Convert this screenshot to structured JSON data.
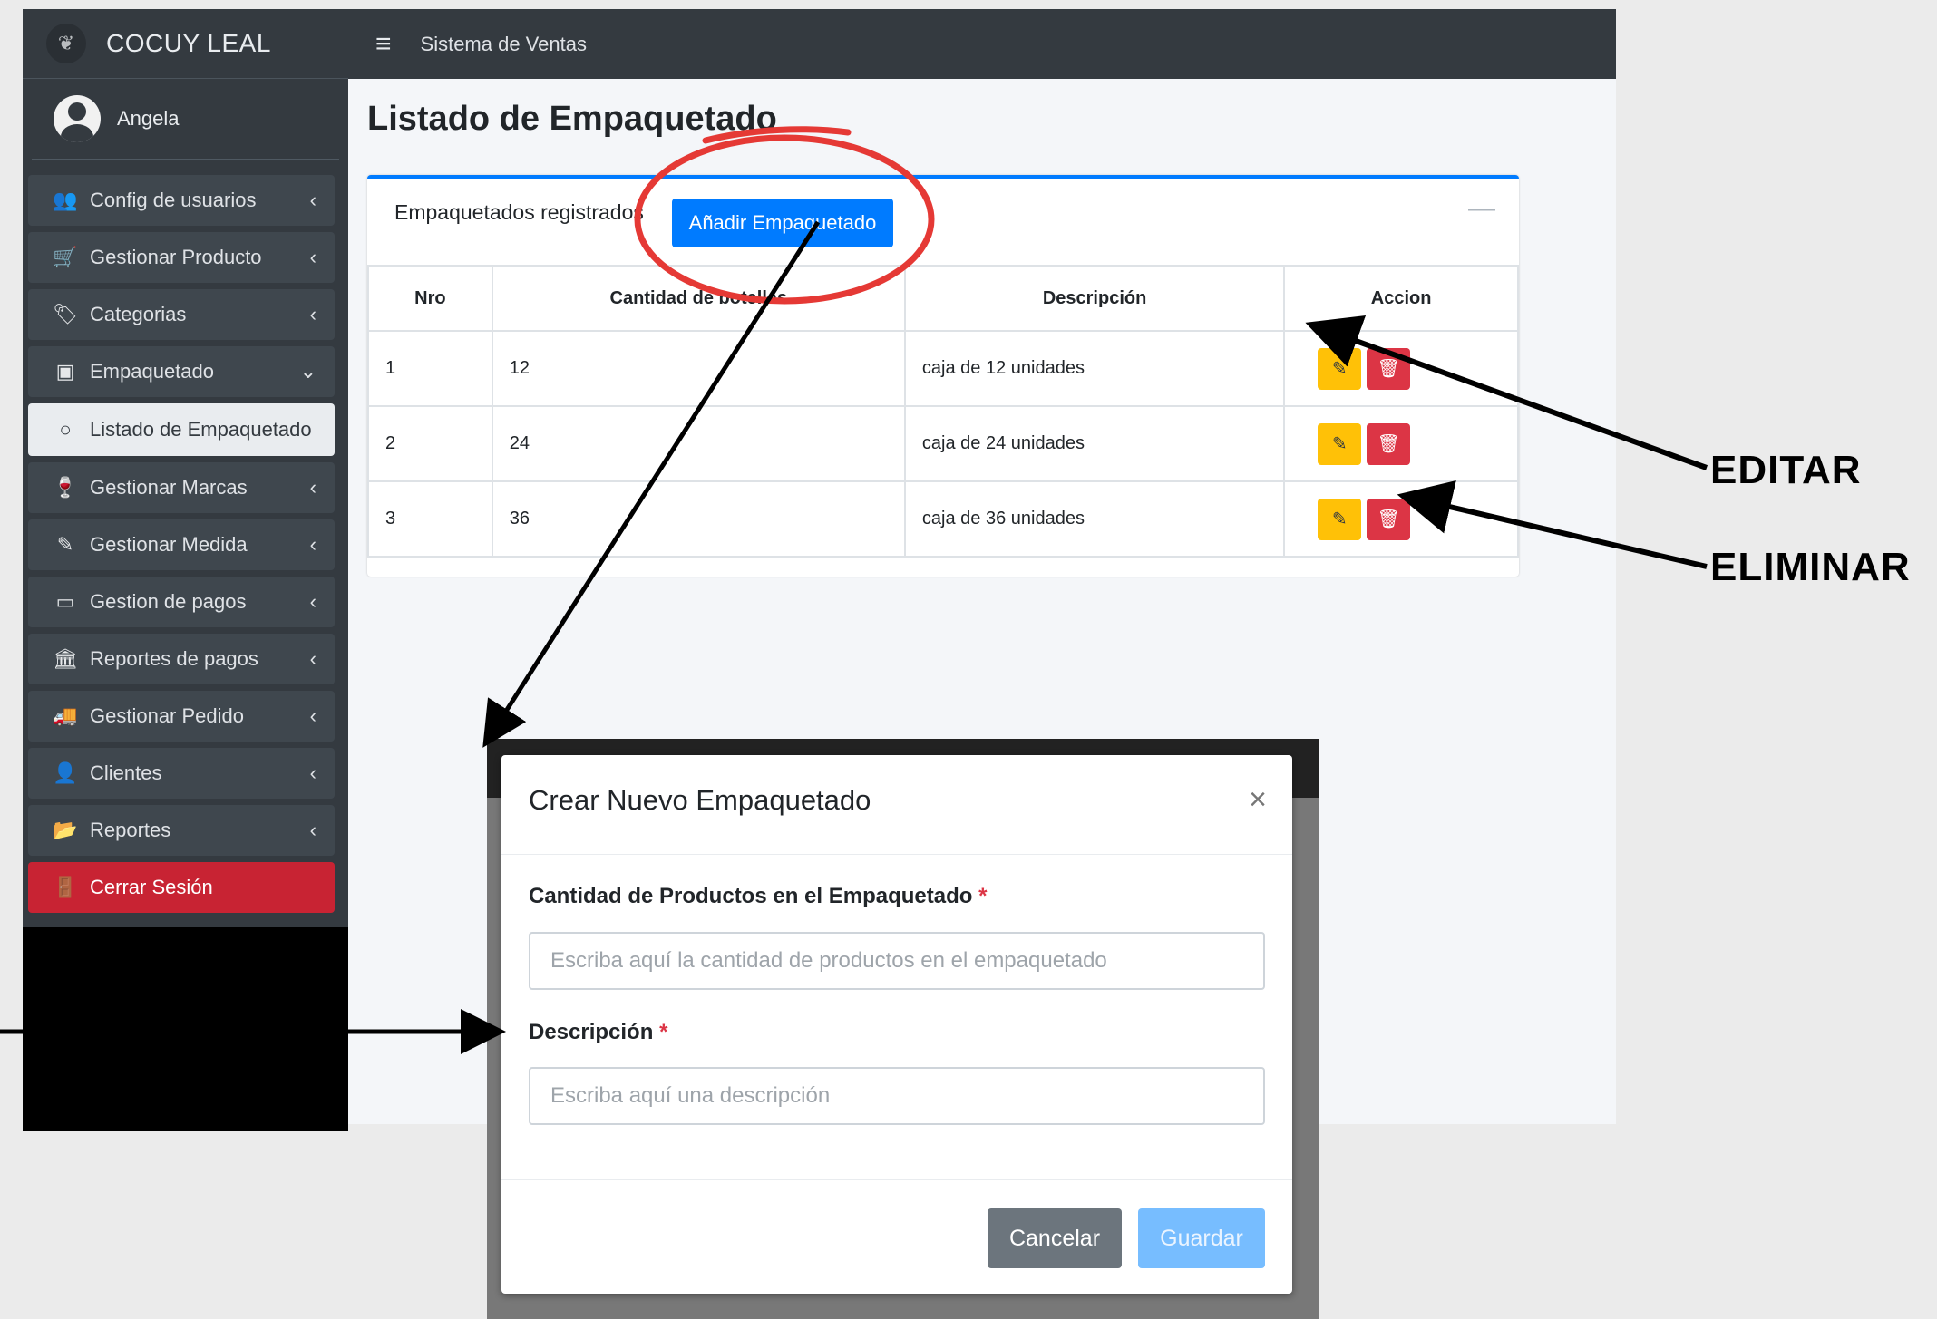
{
  "brand": {
    "name": "COCUY LEAL",
    "logo_icon": "leaf-logo-icon"
  },
  "user": {
    "name": "Angela"
  },
  "topbar": {
    "title": "Sistema de Ventas"
  },
  "sidebar": {
    "items": [
      {
        "label": "Config de usuarios",
        "icon": "users-icon"
      },
      {
        "label": "Gestionar Producto",
        "icon": "cart-icon"
      },
      {
        "label": "Categorias",
        "icon": "tags-icon"
      },
      {
        "label": "Empaquetado",
        "icon": "box-icon"
      },
      {
        "label": "Listado de Empaquetado",
        "icon": "circle-icon"
      },
      {
        "label": "Gestionar Marcas",
        "icon": "wine-icon"
      },
      {
        "label": "Gestionar Medida",
        "icon": "eyedropper-icon"
      },
      {
        "label": "Gestion de pagos",
        "icon": "credit-card-icon"
      },
      {
        "label": "Reportes de pagos",
        "icon": "bank-icon"
      },
      {
        "label": "Gestionar Pedido",
        "icon": "truck-icon"
      },
      {
        "label": "Clientes",
        "icon": "user-tie-icon"
      },
      {
        "label": "Reportes",
        "icon": "folder-icon"
      },
      {
        "label": "Cerrar Sesión",
        "icon": "door-icon"
      }
    ]
  },
  "page": {
    "title": "Listado de Empaquetado",
    "card_title": "Empaquetados registrados",
    "add_button": "Añadir Empaquetado"
  },
  "table": {
    "headers": [
      "Nro",
      "Cantidad de botellas",
      "Descripción",
      "Accion"
    ],
    "rows": [
      {
        "nro": "1",
        "cantidad": "12",
        "descripcion": "caja de 12 unidades"
      },
      {
        "nro": "2",
        "cantidad": "24",
        "descripcion": "caja de 24 unidades"
      },
      {
        "nro": "3",
        "cantidad": "36",
        "descripcion": "caja de 36 unidades"
      }
    ]
  },
  "modal": {
    "title": "Crear Nuevo Empaquetado",
    "close": "×",
    "field1_label": "Cantidad de Productos en el Empaquetado",
    "field1_placeholder": "Escriba aquí la cantidad de productos en el empaquetado",
    "field2_label": "Descripción",
    "field2_placeholder": "Escriba aquí una descripción",
    "required_mark": "*",
    "cancel": "Cancelar",
    "save": "Guardar"
  },
  "annotations": {
    "edit": "EDITAR",
    "delete": "ELIMINAR"
  },
  "colors": {
    "primary": "#007bff",
    "warning": "#ffc107",
    "danger": "#dc3545",
    "sidebar": "#343a40",
    "highlight": "#e53935"
  }
}
